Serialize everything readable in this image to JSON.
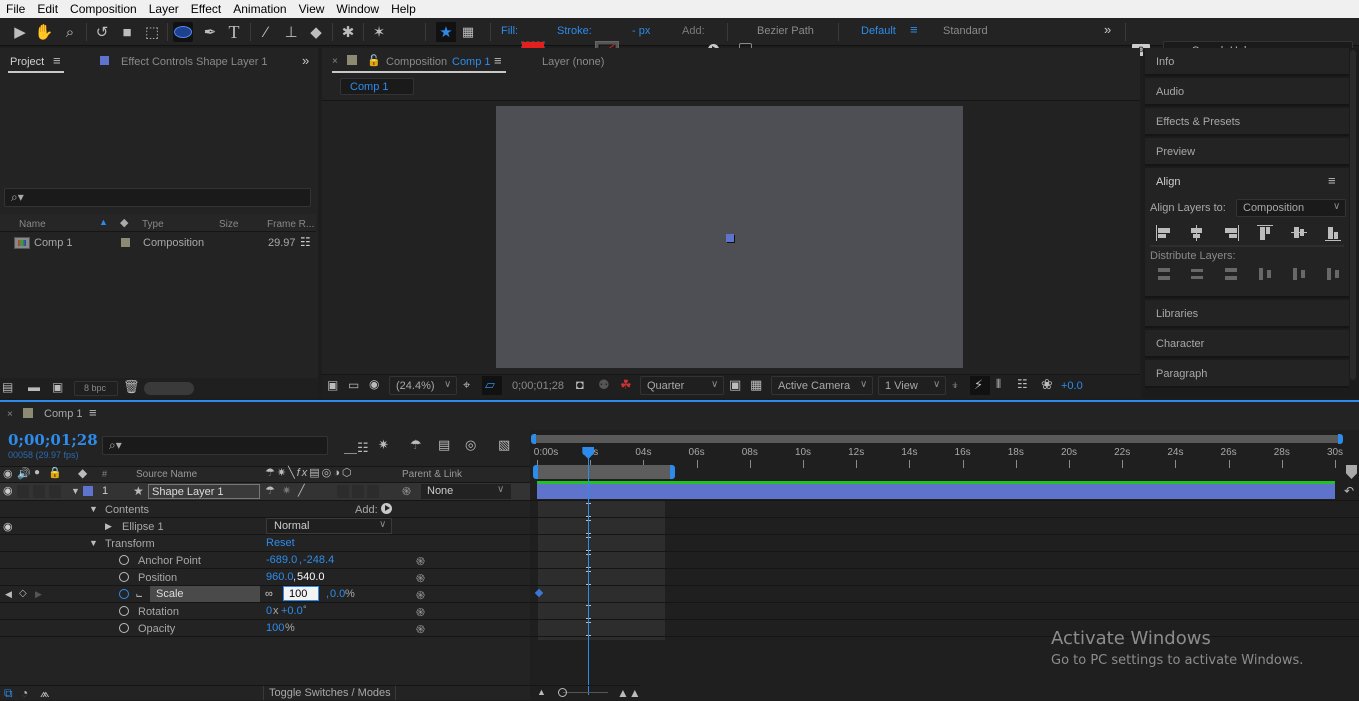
{
  "menu": [
    "File",
    "Edit",
    "Composition",
    "Layer",
    "Effect",
    "Animation",
    "View",
    "Window",
    "Help"
  ],
  "toolbar": {
    "fill_label": "Fill:",
    "fill_color": "#e51e1e",
    "stroke_label": "Stroke:",
    "stroke_width": "- px",
    "add_label": "Add:",
    "bezier_label": "Bezier Path",
    "bezier_checked": false,
    "workspace_active": "Default",
    "workspace_other": "Standard",
    "search_placeholder": "Search Help",
    "tools": [
      "selection-tool",
      "hand-tool",
      "zoom-tool",
      "rotation-tool",
      "camera-tool",
      "pan-behind-tool",
      "ellipse-tool",
      "pen-tool",
      "type-tool",
      "brush-tool",
      "clone-stamp-tool",
      "eraser-tool",
      "roto-brush-tool",
      "puppet-pin-tool"
    ],
    "active_tool": "ellipse-tool"
  },
  "project_panel": {
    "tab_project": "Project",
    "tab_effect_controls": "Effect Controls Shape Layer 1",
    "columns": [
      "Name",
      "Type",
      "Size",
      "Frame R..."
    ],
    "items": [
      {
        "name": "Comp 1",
        "type": "Composition",
        "size": "",
        "frame_rate": "29.97"
      }
    ],
    "bpc": "8 bpc"
  },
  "composition_panel": {
    "tab_prefix": "Composition",
    "tab_name": "Comp 1",
    "layer_tab": "Layer (none)",
    "breadcrumb": "Comp 1",
    "canvas_color": "#4e4f55",
    "zoom": "(24.4%)",
    "timecode": "0;00;01;28",
    "resolution": "Quarter",
    "camera": "Active Camera",
    "views": "1 View",
    "exposure": "+0.0"
  },
  "right_panel": {
    "items": [
      "Info",
      "Audio",
      "Effects & Presets",
      "Preview"
    ],
    "align": {
      "title": "Align",
      "align_to_label": "Align Layers to:",
      "align_to_value": "Composition",
      "distribute_label": "Distribute Layers:"
    },
    "items_bottom": [
      "Libraries",
      "Character",
      "Paragraph"
    ]
  },
  "timeline": {
    "tab_name": "Comp 1",
    "timecode": "0;00;01;28",
    "frame_info": "00058 (29.97 fps)",
    "columns": {
      "source_name": "Source Name",
      "parent_link": "Parent & Link",
      "number": "#"
    },
    "layer": {
      "number": "1",
      "name": "Shape Layer 1",
      "parent": "None",
      "color": "#5e73cc"
    },
    "contents_label": "Contents",
    "add_label": "Add:",
    "ellipse_label": "Ellipse 1",
    "blend_mode": "Normal",
    "transform_label": "Transform",
    "reset_label": "Reset",
    "properties": [
      {
        "name": "Anchor Point",
        "value1": "-689.0",
        "value2": "-248.4",
        "suffix": ""
      },
      {
        "name": "Position",
        "value1": "960.0",
        "value2": "540.0",
        "suffix": ""
      },
      {
        "name": "Scale",
        "value1": "100",
        "value2": "0.0",
        "suffix": "%"
      },
      {
        "name": "Rotation",
        "value1": "0",
        "value2": "+0.0",
        "suffix": "°"
      },
      {
        "name": "Opacity",
        "value1": "100",
        "value2": "",
        "suffix": "%"
      }
    ],
    "ruler_labels": [
      "0:00s",
      "02s",
      "04s",
      "06s",
      "08s",
      "10s",
      "12s",
      "14s",
      "16s",
      "18s",
      "20s",
      "22s",
      "24s",
      "26s",
      "28s",
      "30s"
    ],
    "playhead_seconds": 1.93,
    "duration_seconds": 30,
    "work_area_end_seconds": 5,
    "toggle_label": "Toggle Switches / Modes"
  },
  "watermark": {
    "title": "Activate Windows",
    "subtitle": "Go to PC settings to activate Windows."
  }
}
